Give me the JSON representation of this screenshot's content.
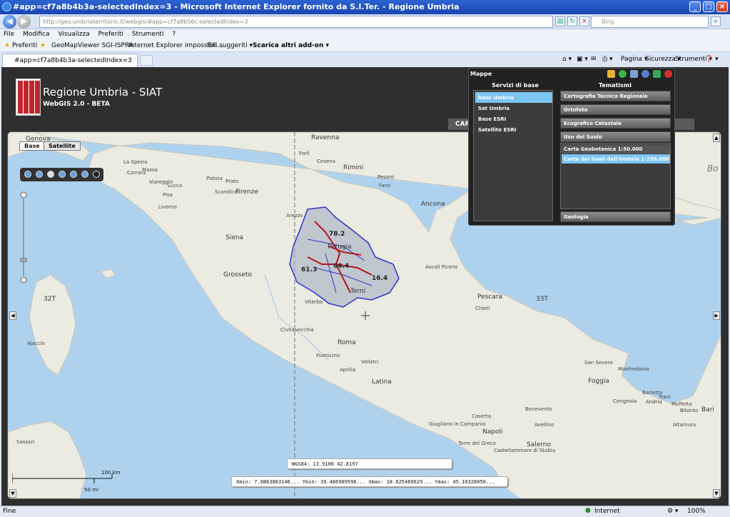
{
  "window": {
    "title": "#app=cf7a8b4b3a-selectedIndex=3 - Microsoft Internet Explorer fornito da S.I.Ter. - Regione Umbria",
    "min": "_",
    "max": "□",
    "close": "×"
  },
  "address": {
    "url": "http://geo.umbriaterritorio.it/webgis/#app=cf7a8b56c-selectedIndex=3",
    "search_placeholder": "Bing",
    "back": "◀",
    "forward": "▶"
  },
  "menu": [
    "File",
    "Modifica",
    "Visualizza",
    "Preferiti",
    "Strumenti",
    "?"
  ],
  "favorites": {
    "label": "Preferiti",
    "items": [
      "GeoMapViewer SGI-ISPRA",
      "Internet Explorer impossibil...",
      "Siti suggeriti ▾",
      "Scarica altri add-on ▾"
    ]
  },
  "tab": {
    "title": "#app=cf7a8b4b3a-selectedIndex=3"
  },
  "commands": [
    "Pagina ▾",
    "Sicurezza ▾",
    "Strumenti ▾",
    "❓ ▾"
  ],
  "app": {
    "title": "Regione Umbria - SIAT",
    "subtitle": "WebGIS 2.0 - BETA",
    "tab_partial": "CAR"
  },
  "map": {
    "tabs": [
      "Base",
      "Satellite"
    ],
    "wgs84": "WGS84:  13.9106  42.8197",
    "extent": "Xmin: 7.0863883146...  Ymin: 39.486909596...  Xmax: 18.625469629...  Ymax: 45.10328050...",
    "scale_km": "100 km",
    "scale_mi": "50 mi",
    "region_values": [
      "78.2",
      "64.4",
      "61.3",
      "16.4"
    ],
    "labels": {
      "genova": "Genova",
      "ravenna": "Ravenna",
      "forli": "Forlì",
      "cesena": "Cesena",
      "rimini": "Rimini",
      "massa": "Massa",
      "carrara": "Carrara",
      "viareggio": "Viareggio",
      "lucca": "Lucca",
      "pistoia": "Pistoia",
      "prato": "Prato",
      "pisa": "Pisa",
      "livorno": "Livorno",
      "scandicci": "Scandicci",
      "firenze": "Firenze",
      "pesaro": "Pesaro",
      "fano": "Fano",
      "ancona": "Ancona",
      "arezzo": "Arezzo",
      "perugia": "Perugia",
      "siena": "Siena",
      "grosseto": "Grosseto",
      "terni": "Terni",
      "viterbo": "Viterbo",
      "ascoli": "Ascoli Piceno",
      "pescara": "Pescara",
      "chieti": "Chieti",
      "roma": "Roma",
      "civitavecchia": "Civitavecchia",
      "fiumicino": "Fiumicino",
      "aprilia": "Aprilia",
      "velletri": "Velletri",
      "latina": "Latina",
      "caserta": "Caserta",
      "napoli": "Napoli",
      "giugliano": "Giugliano in Campania",
      "torre": "Torre del Greco",
      "castellammare": "Castellammare di Stabia",
      "salerno": "Salerno",
      "benevento": "Benevento",
      "avellino": "Avellino",
      "foggia": "Foggia",
      "barletta": "Barletta",
      "trani": "Trani",
      "andria": "Andria",
      "molfetta": "Molfetta",
      "bitonto": "Bitonto",
      "bari": "Bari",
      "altamura": "Altamura",
      "sansevero": "San Severo",
      "manfredonia": "Manfredonia",
      "cerignola": "Cerignola",
      "ajaccio": "Ajaccio",
      "sassari": "Sassari",
      "la_spezia": "La Spezia",
      "bo": "Bo",
      "zone32": "32T",
      "zone33": "33T"
    }
  },
  "panel": {
    "title": "Mappe",
    "col_left": "Servizi di base",
    "col_right": "Tematismi",
    "base_items": [
      "Base Umbria",
      "Sat Umbria",
      "Base ESRI",
      "Satellite ESRI"
    ],
    "themes": [
      "Cartografia Tecnica Regionale",
      "Ortofoto",
      "Ecografico Catastale",
      "Uso del Suolo",
      "Geologia"
    ],
    "sub_items": [
      "Carta Geobotanica 1:50.000",
      "Carta dei Suoli dell'Umbria 1:250.000"
    ]
  },
  "status": {
    "left": "Fine",
    "zone": "Internet",
    "zoom": "100%"
  }
}
